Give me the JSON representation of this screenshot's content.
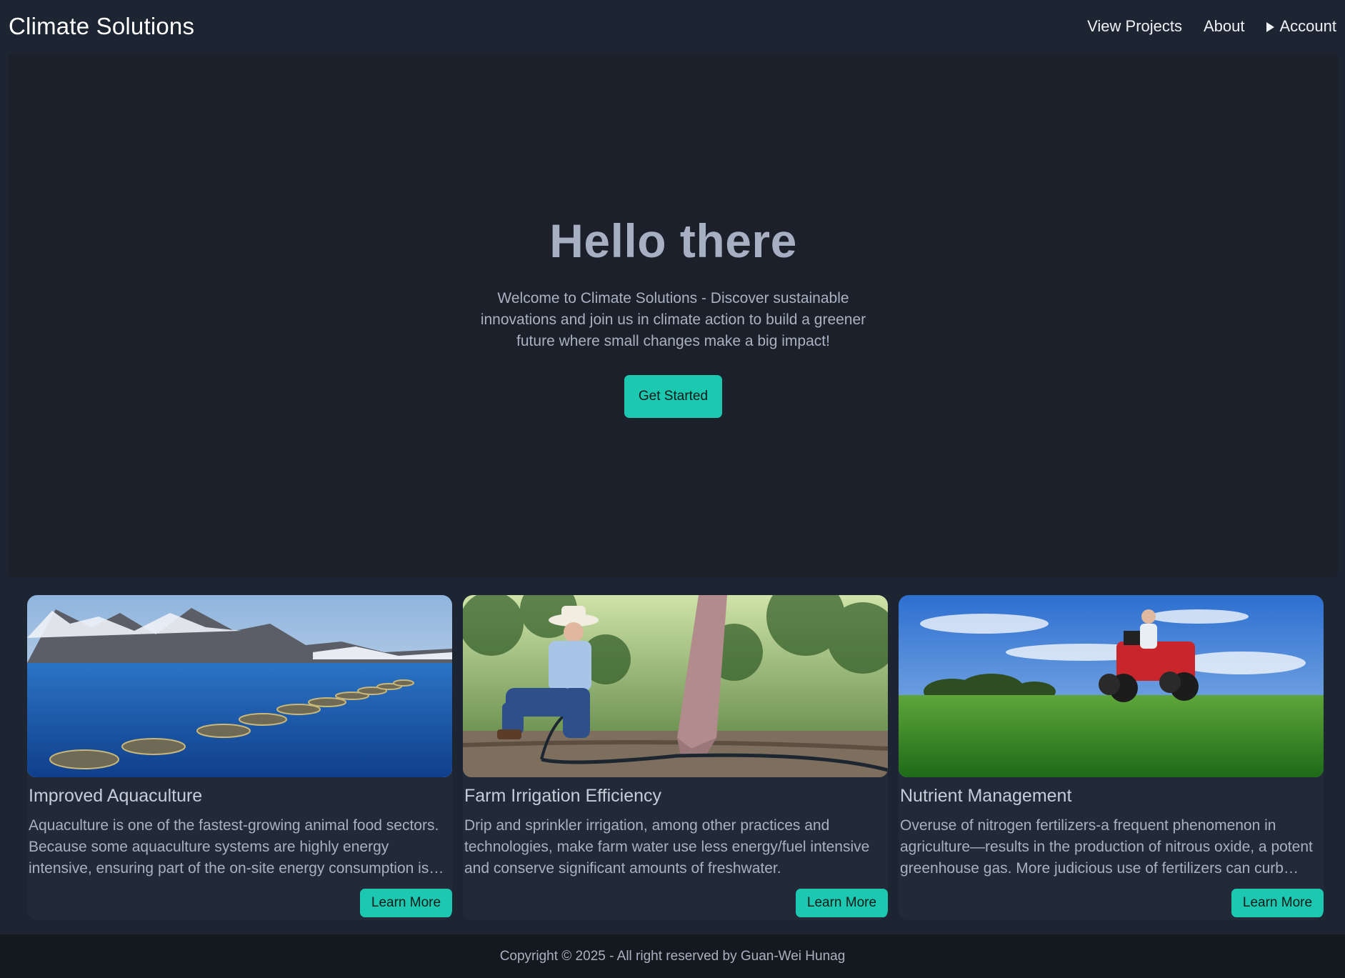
{
  "header": {
    "brand": "Climate Solutions",
    "nav": {
      "view_projects": "View Projects",
      "about": "About",
      "account": "Account"
    }
  },
  "hero": {
    "title": "Hello there",
    "subtitle": "Welcome to Climate Solutions - Discover sustainable innovations and join us in climate action to build a greener future where small changes make a big impact!",
    "cta": "Get Started"
  },
  "cards": [
    {
      "title": "Improved Aquaculture",
      "description": "Aquaculture is one of the fastest-growing animal food sectors. Because some aquaculture systems are highly energy intensive, ensuring part of the on-site energy consumption is based on renewable sources can reduce emissions.",
      "button": "Learn More",
      "image_icon": "fjord-fish-pens-image"
    },
    {
      "title": "Farm Irrigation Efficiency",
      "description": "Drip and sprinkler irrigation, among other practices and technologies, make farm water use less energy/fuel intensive and conserve significant amounts of freshwater.",
      "button": "Learn More",
      "image_icon": "orchard-drip-irrigation-image"
    },
    {
      "title": "Nutrient Management",
      "description": "Overuse of nitrogen fertilizers-a frequent phenomenon in agriculture—results in the production of nitrous oxide, a potent greenhouse gas. More judicious use of fertilizers can curb these emissions.",
      "button": "Learn More",
      "image_icon": "atv-field-image"
    }
  ],
  "footer": {
    "copyright": "Copyright © 2025 - All right reserved by Guan-Wei Hunag"
  },
  "colors": {
    "background": "#1d2432",
    "hero_bg": "#1b202a",
    "card_bg": "#222938",
    "accent": "#1cc9b0",
    "footer_bg": "#14181f"
  }
}
